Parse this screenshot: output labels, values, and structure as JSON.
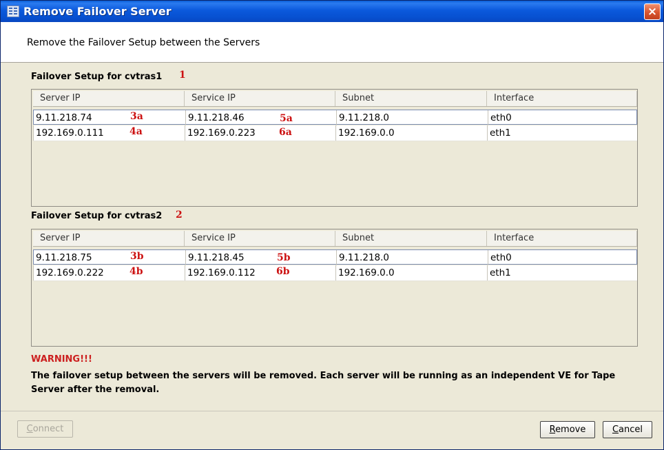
{
  "window": {
    "title": "Remove Failover Server",
    "close_label": "×"
  },
  "header": {
    "text": "Remove the Failover Setup between the Servers"
  },
  "sections": [
    {
      "title": "Failover Setup for cvtras1",
      "marker": "1",
      "columns": [
        "Server IP",
        "Service IP",
        "Subnet",
        "Interface"
      ],
      "rows": [
        {
          "server_ip": "9.11.218.74",
          "server_marker": "3a",
          "service_ip": "9.11.218.46",
          "service_marker": "5a",
          "subnet": "9.11.218.0",
          "interface": "eth0"
        },
        {
          "server_ip": "192.169.0.111",
          "server_marker": "4a",
          "service_ip": "192.169.0.223",
          "service_marker": "6a",
          "subnet": "192.169.0.0",
          "interface": "eth1"
        }
      ]
    },
    {
      "title": "Failover Setup for cvtras2",
      "marker": "2",
      "columns": [
        "Server IP",
        "Service IP",
        "Subnet",
        "Interface"
      ],
      "rows": [
        {
          "server_ip": "9.11.218.75",
          "server_marker": "3b",
          "service_ip": "9.11.218.45",
          "service_marker": "5b",
          "subnet": "9.11.218.0",
          "interface": "eth0"
        },
        {
          "server_ip": "192.169.0.222",
          "server_marker": "4b",
          "service_ip": "192.169.0.112",
          "service_marker": "6b",
          "subnet": "192.169.0.0",
          "interface": "eth1"
        }
      ]
    }
  ],
  "warning": {
    "title": "WARNING!!!",
    "text": "The failover setup between the servers will be removed. Each server will be running as an independent VE for Tape Server after the removal."
  },
  "buttons": {
    "connect": {
      "first": "C",
      "rest": "onnect"
    },
    "remove": {
      "first": "R",
      "rest": "emove"
    },
    "cancel": {
      "first": "C",
      "rest": "ancel"
    }
  },
  "colors": {
    "title_bar": "#0b59dc",
    "marker": "#cc1111",
    "warning": "#cc1f1f"
  }
}
